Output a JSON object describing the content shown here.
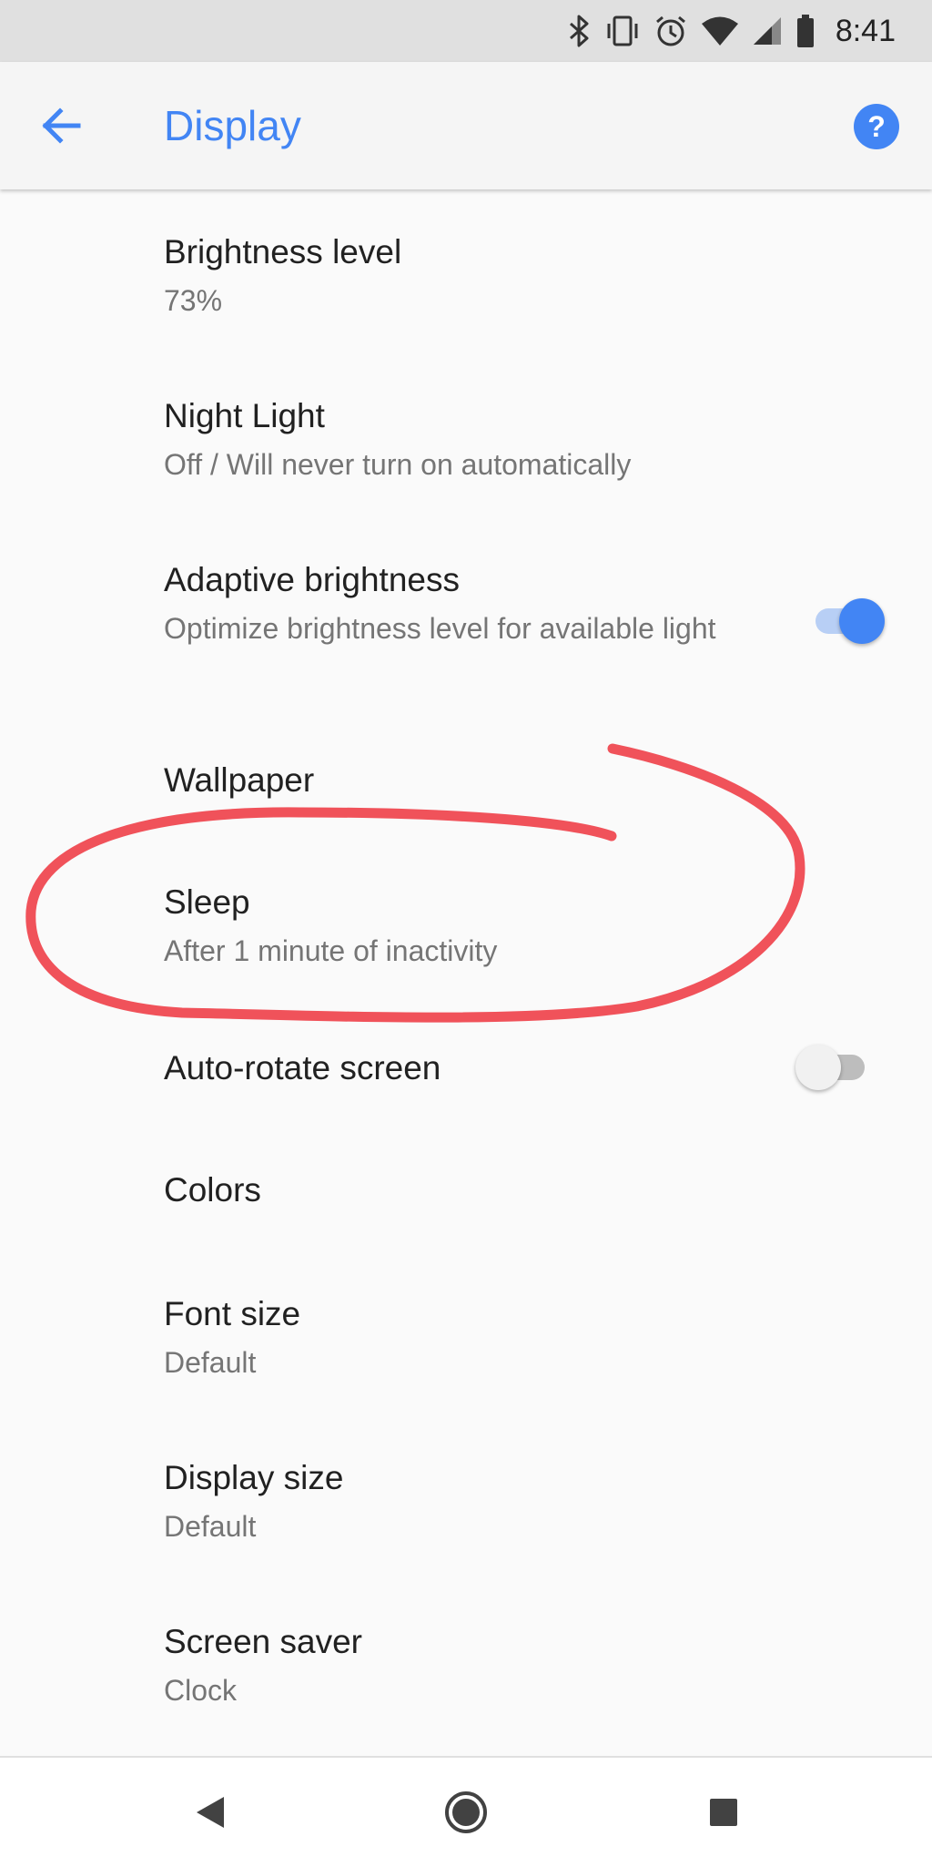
{
  "status_bar": {
    "time": "8:41",
    "icons": [
      "bluetooth-icon",
      "vibrate-icon",
      "alarm-icon",
      "wifi-icon",
      "cell-signal-icon",
      "battery-icon"
    ]
  },
  "app_bar": {
    "title": "Display",
    "back_icon": "arrow-back-icon",
    "help_icon": "help-icon",
    "accent_color": "#4285f4"
  },
  "settings": {
    "items": [
      {
        "title": "Brightness level",
        "summary": "73%"
      },
      {
        "title": "Night Light",
        "summary": "Off / Will never turn on automatically"
      },
      {
        "title": "Adaptive brightness",
        "summary": "Optimize brightness level for available light",
        "toggle": true
      },
      {
        "title": "Wallpaper"
      },
      {
        "title": "Sleep",
        "summary": "After 1 minute of inactivity",
        "highlighted": true
      },
      {
        "title": "Auto-rotate screen",
        "toggle": false
      },
      {
        "title": "Colors"
      },
      {
        "title": "Font size",
        "summary": "Default"
      },
      {
        "title": "Display size",
        "summary": "Default"
      },
      {
        "title": "Screen saver",
        "summary": "Clock"
      }
    ]
  },
  "annotation": {
    "color": "#f0525a"
  },
  "nav_bar": {
    "icons": [
      "back-triangle-icon",
      "home-circle-icon",
      "recents-square-icon"
    ]
  }
}
